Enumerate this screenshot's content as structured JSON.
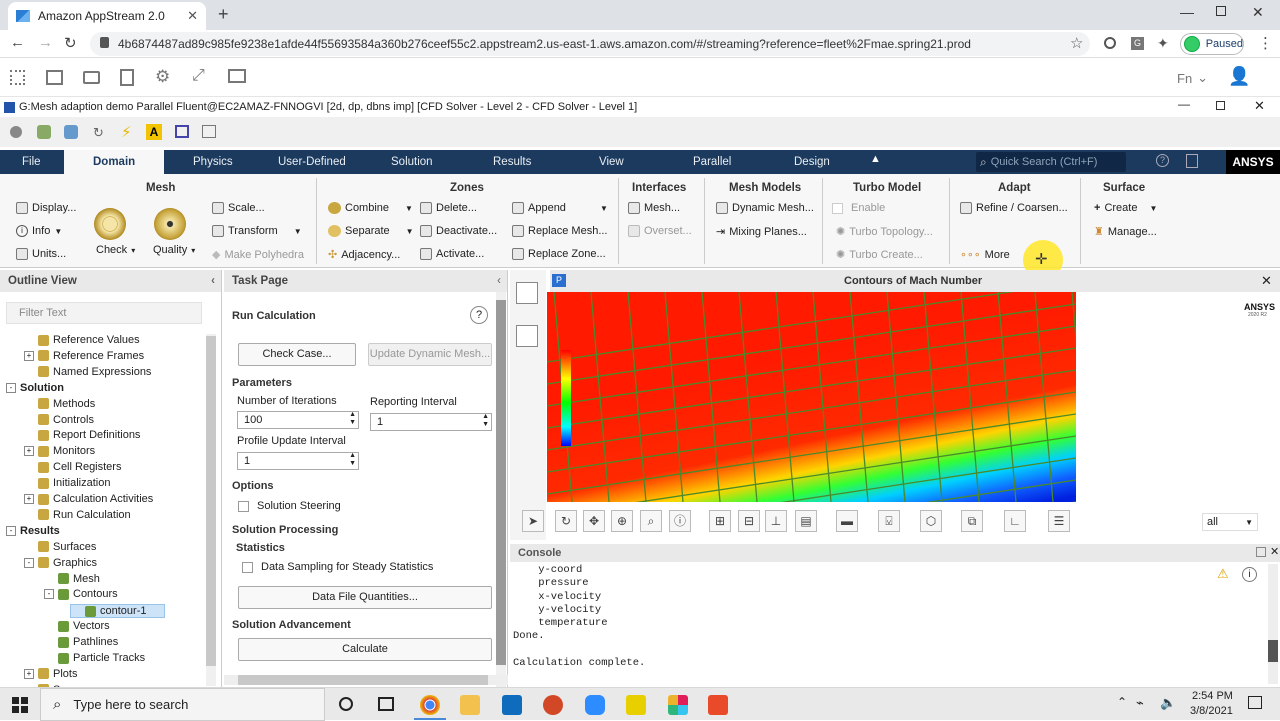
{
  "browser": {
    "tab_title": "Amazon AppStream 2.0",
    "url": "4b6874487ad89c985fe9238e1afde44f55693584a360b276ceef55c2.appstream2.us-east-1.aws.amazon.com/#/streaming?reference=fleet%2Fmae.spring21.prod",
    "profile_status": "Paused",
    "lang": "Fn"
  },
  "window": {
    "title": "G:Mesh adaption demo Parallel Fluent@EC2AMAZ-FNNOGVI  [2d, dp, dbns imp] [CFD Solver - Level 2 - CFD Solver - Level 1]"
  },
  "menu": {
    "items": [
      "File",
      "Domain",
      "Physics",
      "User-Defined",
      "Solution",
      "Results",
      "View",
      "Parallel",
      "Design"
    ],
    "active": "Domain",
    "search_placeholder": "Quick Search (Ctrl+F)",
    "brand": "ANSYS"
  },
  "ribbon": {
    "mesh": {
      "title": "Mesh",
      "display": "Display...",
      "info": "Info",
      "units": "Units...",
      "check": "Check",
      "quality": "Quality",
      "scale": "Scale...",
      "transform": "Transform",
      "polyhedra": "Make Polyhedra"
    },
    "zones": {
      "title": "Zones",
      "combine": "Combine",
      "separate": "Separate",
      "adjacency": "Adjacency...",
      "delete": "Delete...",
      "deactivate": "Deactivate...",
      "activate": "Activate...",
      "append": "Append",
      "replace_mesh": "Replace Mesh...",
      "replace_zone": "Replace Zone..."
    },
    "interfaces": {
      "title": "Interfaces",
      "mesh": "Mesh...",
      "overset": "Overset..."
    },
    "mesh_models": {
      "title": "Mesh Models",
      "dynamic": "Dynamic Mesh...",
      "mixing": "Mixing Planes..."
    },
    "turbo": {
      "title": "Turbo Model",
      "enable": "Enable",
      "topology": "Turbo Topology...",
      "create": "Turbo Create..."
    },
    "adapt": {
      "title": "Adapt",
      "refine": "Refine / Coarsen...",
      "more": "More"
    },
    "surface": {
      "title": "Surface",
      "create": "Create",
      "manage": "Manage..."
    }
  },
  "outline": {
    "title": "Outline View",
    "filter_placeholder": "Filter Text",
    "items": [
      {
        "label": "Reference Values",
        "indent": 2,
        "exp": ""
      },
      {
        "label": "Reference Frames",
        "indent": 2,
        "exp": "+"
      },
      {
        "label": "Named Expressions",
        "indent": 2,
        "exp": ""
      },
      {
        "label": "Solution",
        "indent": 0,
        "exp": "-",
        "bold": true
      },
      {
        "label": "Methods",
        "indent": 2,
        "exp": ""
      },
      {
        "label": "Controls",
        "indent": 2,
        "exp": ""
      },
      {
        "label": "Report Definitions",
        "indent": 2,
        "exp": ""
      },
      {
        "label": "Monitors",
        "indent": 2,
        "exp": "+"
      },
      {
        "label": "Cell Registers",
        "indent": 2,
        "exp": ""
      },
      {
        "label": "Initialization",
        "indent": 2,
        "exp": ""
      },
      {
        "label": "Calculation Activities",
        "indent": 2,
        "exp": "+"
      },
      {
        "label": "Run Calculation",
        "indent": 2,
        "exp": ""
      },
      {
        "label": "Results",
        "indent": 0,
        "exp": "-",
        "bold": true
      },
      {
        "label": "Surfaces",
        "indent": 2,
        "exp": ""
      },
      {
        "label": "Graphics",
        "indent": 2,
        "exp": "-"
      },
      {
        "label": "Mesh",
        "indent": 3,
        "exp": ""
      },
      {
        "label": "Contours",
        "indent": 3,
        "exp": "-"
      },
      {
        "label": "contour-1",
        "indent": 4,
        "exp": "",
        "selected": true
      },
      {
        "label": "Vectors",
        "indent": 3,
        "exp": ""
      },
      {
        "label": "Pathlines",
        "indent": 3,
        "exp": ""
      },
      {
        "label": "Particle Tracks",
        "indent": 3,
        "exp": ""
      },
      {
        "label": "Plots",
        "indent": 2,
        "exp": "+"
      },
      {
        "label": "Scene",
        "indent": 2,
        "exp": ""
      }
    ]
  },
  "task": {
    "title": "Task Page",
    "heading": "Run Calculation",
    "check_case": "Check Case...",
    "update_dynamic": "Update Dynamic Mesh...",
    "parameters": "Parameters",
    "iter_label": "Number of Iterations",
    "iter_value": "100",
    "report_label": "Reporting Interval",
    "report_value": "1",
    "profile_label": "Profile Update Interval",
    "profile_value": "1",
    "options": "Options",
    "steering": "Solution Steering",
    "processing": "Solution Processing",
    "statistics": "Statistics",
    "sampling": "Data Sampling for Steady Statistics",
    "quantities": "Data File Quantities...",
    "advancement": "Solution Advancement",
    "calculate": "Calculate"
  },
  "graphics": {
    "title": "Contours of Mach Number",
    "brand": "ANSYS",
    "version": "2020 R2",
    "view_select": "all"
  },
  "console": {
    "title": "Console",
    "lines": [
      "    y-coord",
      "    pressure",
      "    x-velocity",
      "    y-velocity",
      "    temperature",
      "Done.",
      "",
      "Calculation complete."
    ]
  },
  "taskbar": {
    "search_placeholder": "Type here to search",
    "time": "2:54 PM",
    "date": "3/8/2021"
  }
}
